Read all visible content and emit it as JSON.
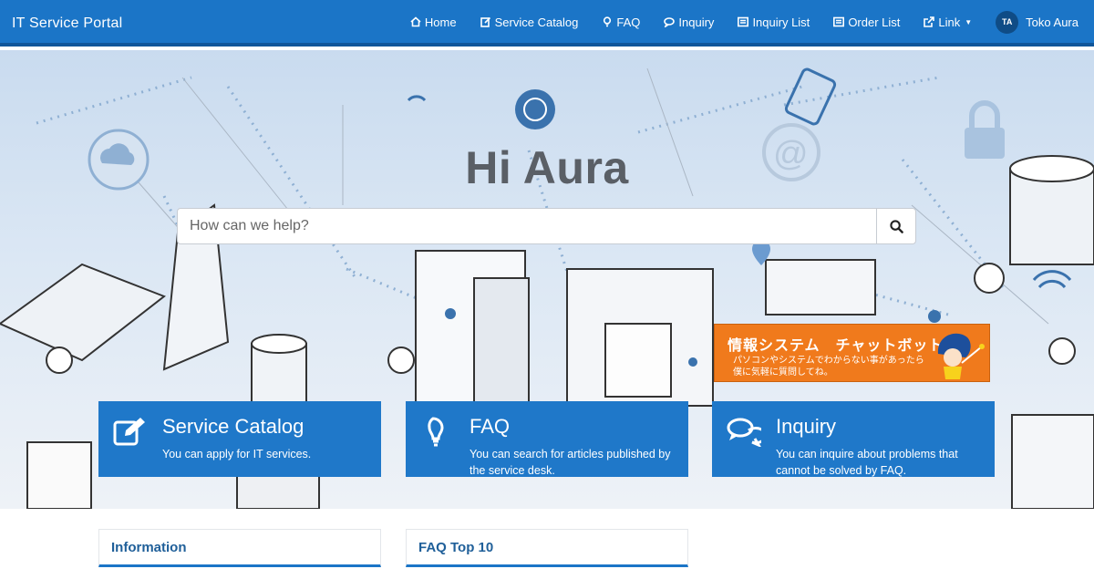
{
  "app": {
    "title": "IT Service Portal"
  },
  "nav": {
    "items": [
      {
        "label": "Home",
        "icon": "home-icon"
      },
      {
        "label": "Service Catalog",
        "icon": "edit-icon"
      },
      {
        "label": "FAQ",
        "icon": "lightbulb-icon"
      },
      {
        "label": "Inquiry",
        "icon": "chat-icon"
      },
      {
        "label": "Inquiry List",
        "icon": "list-icon"
      },
      {
        "label": "Order List",
        "icon": "list-icon"
      },
      {
        "label": "Link",
        "icon": "external-link-icon"
      }
    ],
    "user": {
      "initials": "TA",
      "name": "Toko Aura"
    }
  },
  "hero": {
    "greeting": "Hi Aura",
    "search_placeholder": "How can we help?"
  },
  "chatbot": {
    "title": "情報システム　チャットボット",
    "subtitle_line1": "パソコンやシステムでわからない事があったら",
    "subtitle_line2": "僕に気軽に質問してね。"
  },
  "tiles": [
    {
      "title": "Service Catalog",
      "description": "You can apply for IT services.",
      "icon": "edit-icon"
    },
    {
      "title": "FAQ",
      "description": "You can search for articles published by the service desk.",
      "icon": "lightbulb-icon"
    },
    {
      "title": "Inquiry",
      "description": "You can inquire about problems that cannot be solved by FAQ.",
      "icon": "chat-icon"
    }
  ],
  "panels": [
    {
      "title": "Information"
    },
    {
      "title": "FAQ Top 10"
    }
  ],
  "colors": {
    "navbar": "#1b75c7",
    "tile": "#1f78c9",
    "chatbot": "#f07a1c",
    "panel_title": "#1f5f99"
  }
}
